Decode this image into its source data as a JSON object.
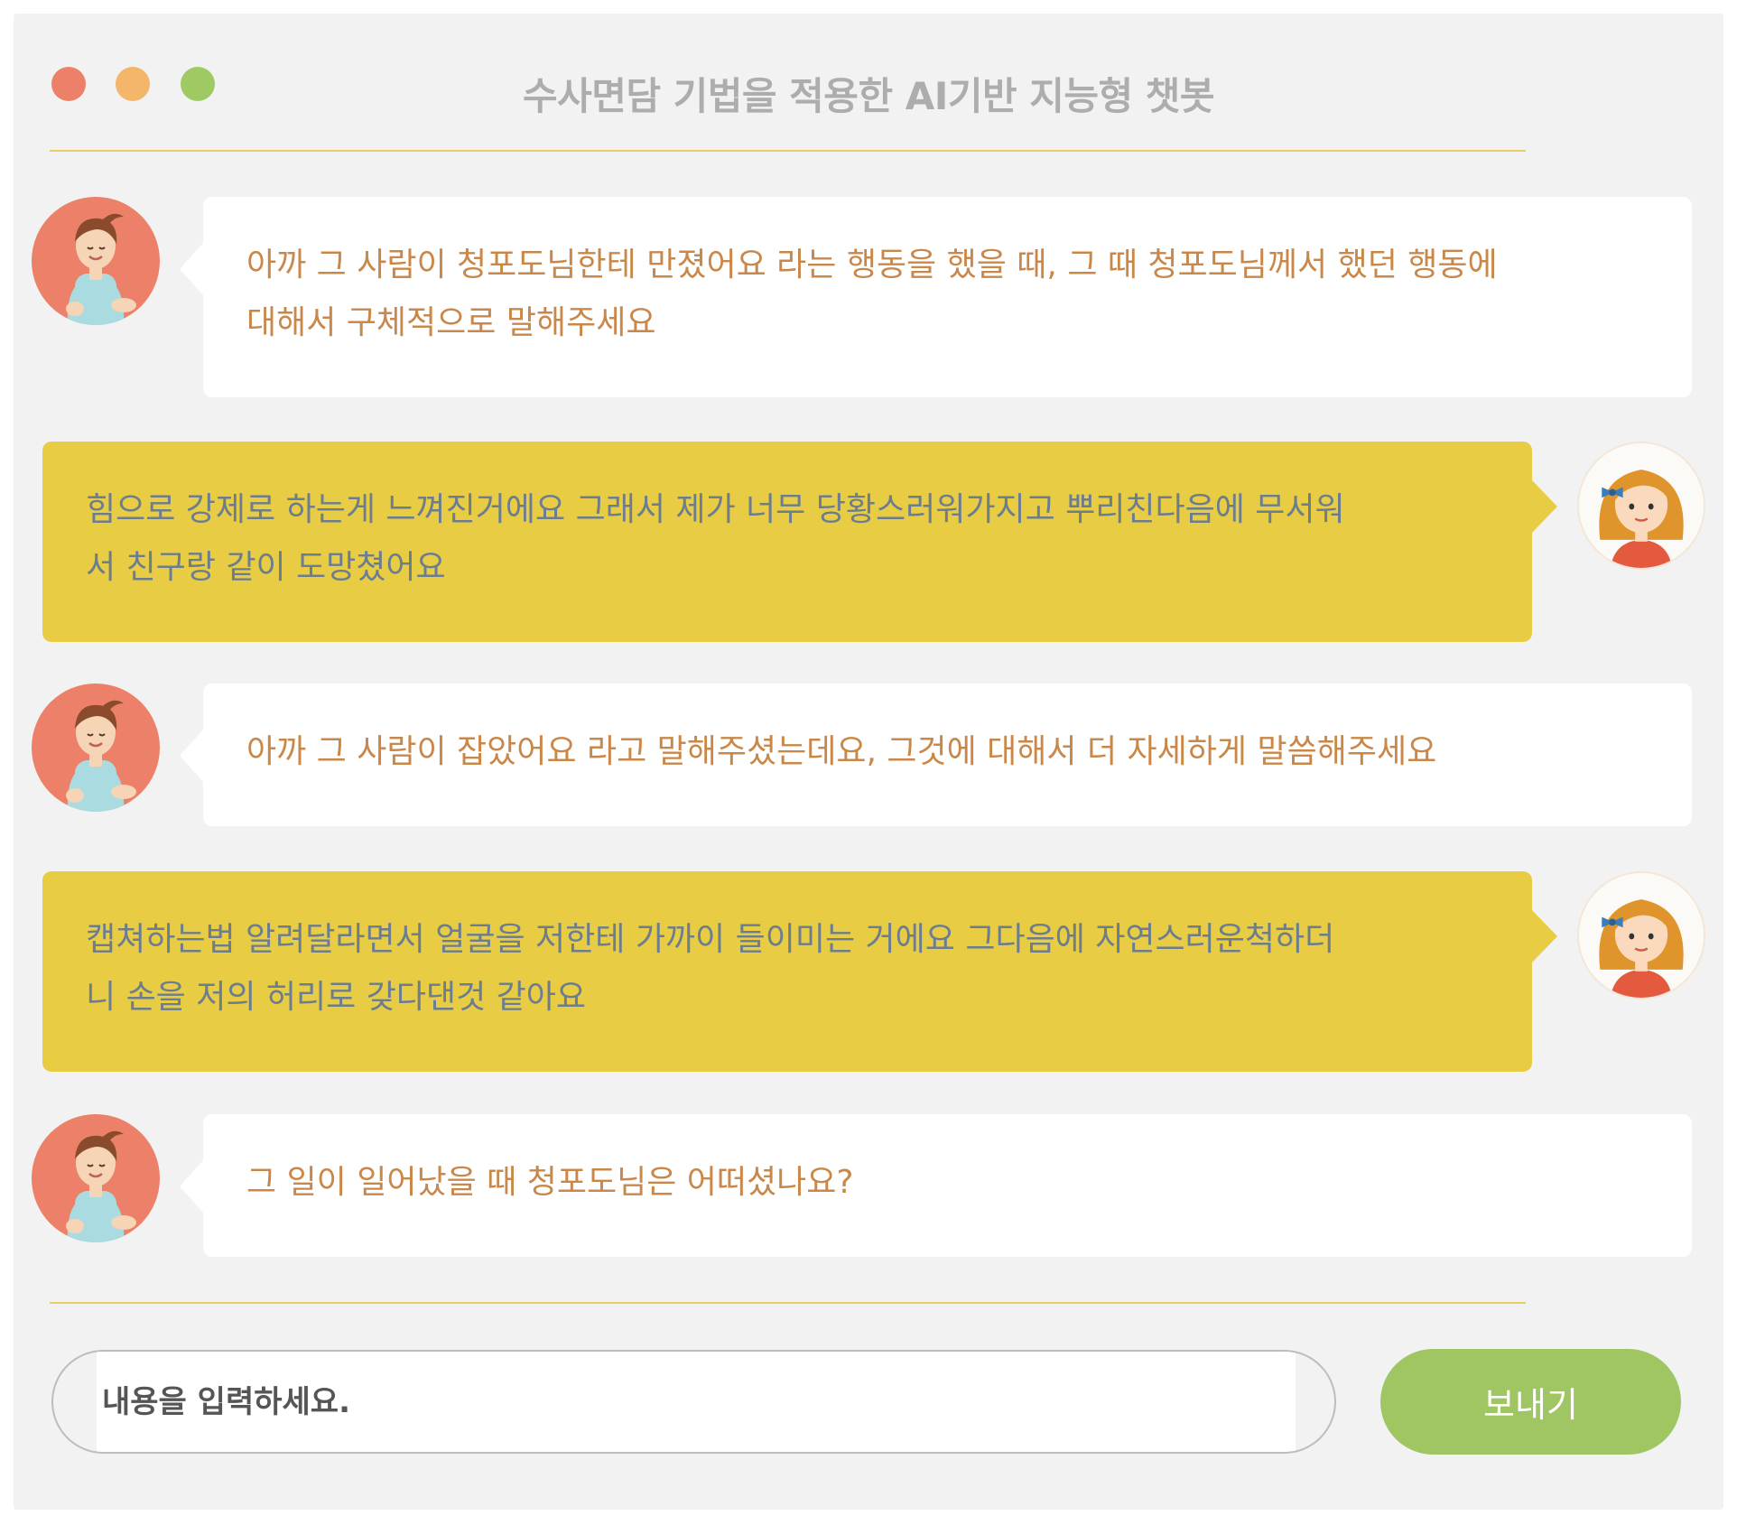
{
  "window": {
    "title": "수사면담 기법을 적용한 AI기반 지능형 챗봇",
    "controls": [
      "close",
      "minimize",
      "maximize"
    ]
  },
  "messages": [
    {
      "sender": "bot",
      "avatar": "counselor-avatar-icon",
      "lines": [
        "아까 그 사람이 청포도님한테 만졌어요 라는 행동을 했을 때, 그 때 청포도님께서 했던 행동에",
        "대해서 구체적으로 말해주세요"
      ]
    },
    {
      "sender": "user",
      "avatar": "girl-avatar-icon",
      "lines": [
        "힘으로 강제로 하는게 느껴진거에요 그래서 제가 너무 당황스러워가지고 뿌리친다음에 무서워",
        "서 친구랑 같이 도망쳤어요"
      ]
    },
    {
      "sender": "bot",
      "avatar": "counselor-avatar-icon",
      "lines": [
        "아까 그 사람이 잡았어요 라고 말해주셨는데요, 그것에 대해서 더 자세하게 말씀해주세요"
      ]
    },
    {
      "sender": "user",
      "avatar": "girl-avatar-icon",
      "lines": [
        "캡쳐하는법 알려달라면서 얼굴을 저한테 가까이 들이미는 거에요 그다음에 자연스러운척하더",
        "니 손을 저의 허리로 갖다댄것 같아요"
      ]
    },
    {
      "sender": "bot",
      "avatar": "counselor-avatar-icon",
      "lines": [
        "그 일이 일어났을 때 청포도님은 어떠셨나요?"
      ]
    }
  ],
  "composer": {
    "placeholder": "내용을 입력하세요.",
    "value": "",
    "send_label": "보내기"
  },
  "colors": {
    "bot_text": "#c9884a",
    "user_bubble": "#e8cc43",
    "user_text": "#6b7d8f",
    "send_button": "#9fc662",
    "divider": "#ebce63"
  }
}
